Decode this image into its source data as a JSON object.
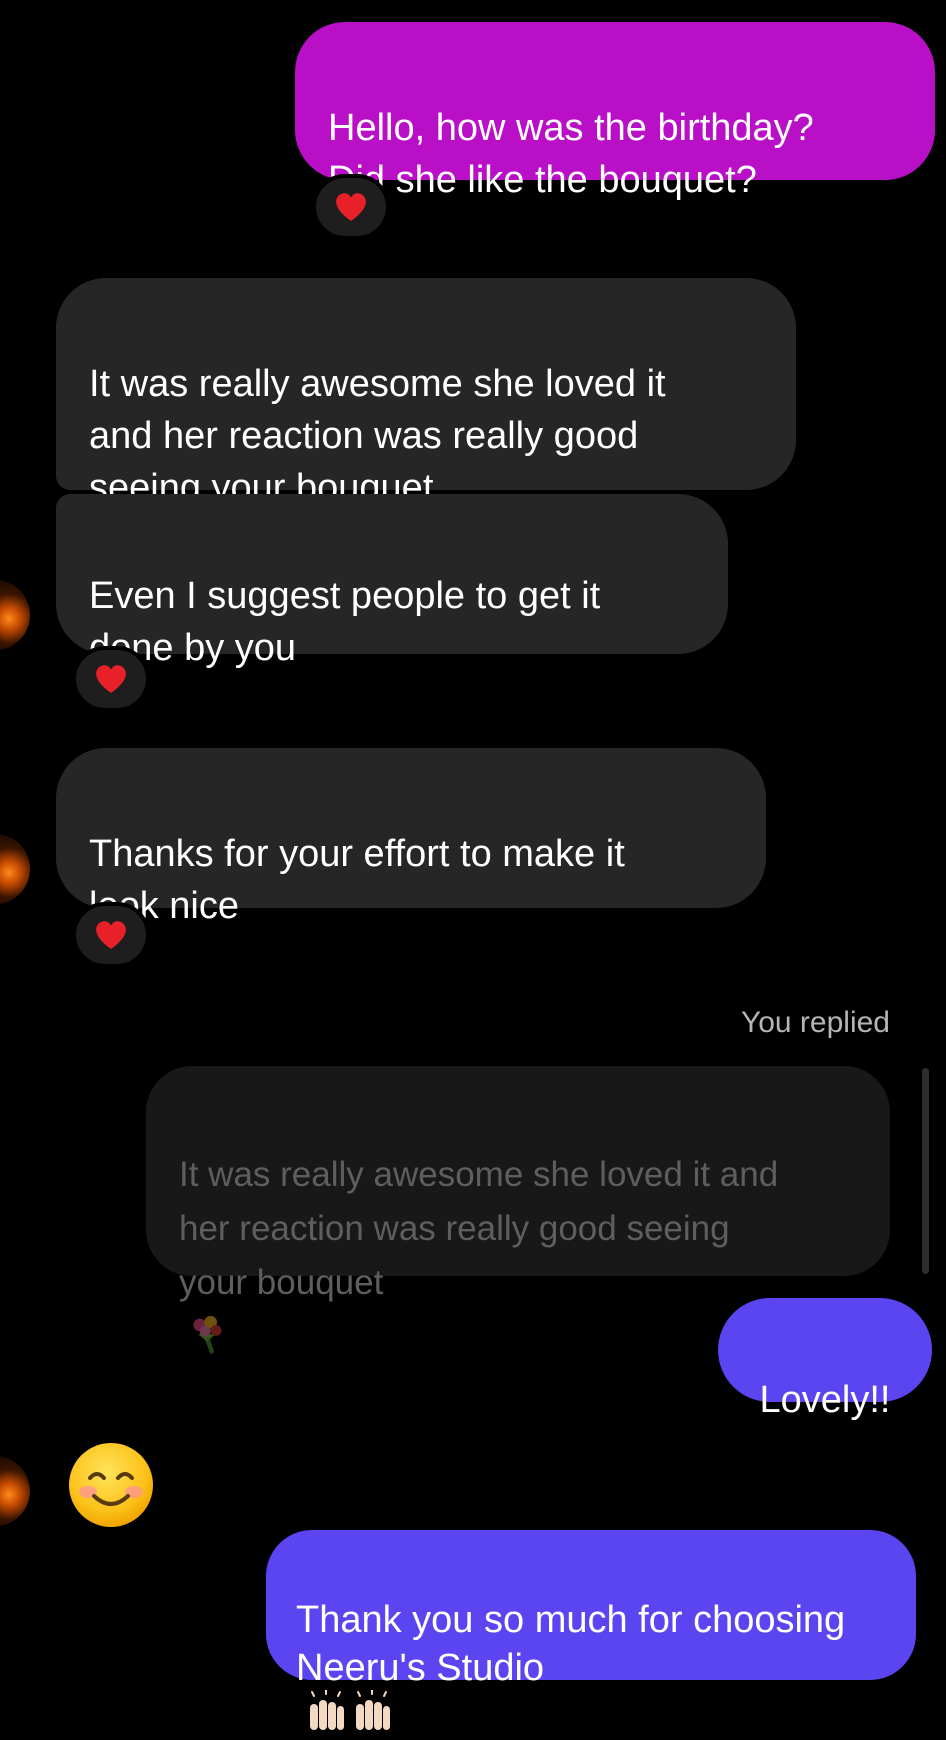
{
  "conversation": {
    "messages": [
      {
        "id": "m1",
        "direction": "outgoing",
        "text": "Hello, how was the birthday?\nDid she like the bouquet?",
        "reaction": "heart"
      },
      {
        "id": "m2",
        "direction": "incoming",
        "text": "It was really awesome she loved it\nand her reaction was really good\nseeing your bouquet"
      },
      {
        "id": "m3",
        "direction": "incoming",
        "text": "Even I suggest people to get it\ndone by you",
        "reaction": "heart"
      },
      {
        "id": "m4",
        "direction": "incoming",
        "text": "Thanks for your effort to make it\nlook nice",
        "reaction": "heart"
      },
      {
        "id": "m5",
        "direction": "outgoing",
        "reply_label": "You replied",
        "quoted_text": "It was really awesome she loved it and\nher reaction was really good seeing\nyour bouquet",
        "text": "Lovely!!"
      },
      {
        "id": "m6",
        "direction": "incoming",
        "emoji": "smiling-face-icon"
      },
      {
        "id": "m7",
        "direction": "outgoing",
        "text": "Thank you so much for choosing\nNeeru's Studio"
      }
    ]
  },
  "colors": {
    "background": "#000000",
    "outgoing_magenta": "#b80fc7",
    "outgoing_blue": "#5b45f0",
    "incoming": "#262626",
    "reaction_heart": "#e8202a"
  }
}
